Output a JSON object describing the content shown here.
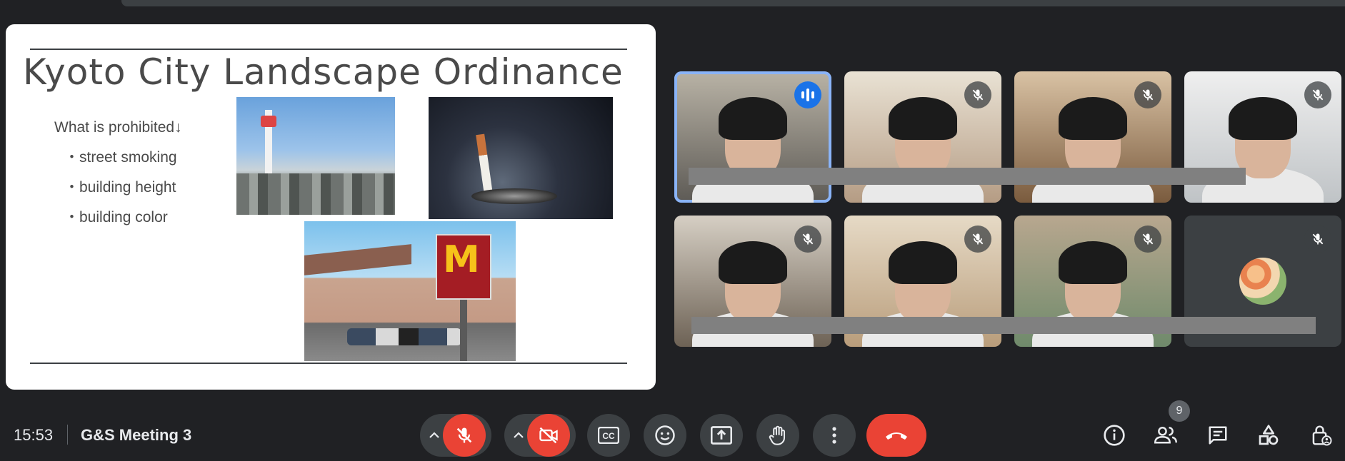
{
  "slide": {
    "title": "Kyoto City Landscape Ordinance",
    "heading": "What is prohibited↓",
    "bullets": [
      "・street smoking",
      "・building height",
      "・building color"
    ],
    "images": [
      "kyoto-tower-photo",
      "cigarette-photo",
      "mcdonalds-sign-photo"
    ],
    "mcd_sign_glyph": "M"
  },
  "participants": [
    {
      "id": "p1",
      "state": "speaking",
      "active": true,
      "colors": [
        "#b9b3a6",
        "#5d5a55"
      ]
    },
    {
      "id": "p2",
      "state": "muted",
      "colors": [
        "#e9e2d4",
        "#b59c84"
      ]
    },
    {
      "id": "p3",
      "state": "muted",
      "colors": [
        "#d9c2a4",
        "#7a5b3e"
      ]
    },
    {
      "id": "p4",
      "state": "muted",
      "colors": [
        "#efefef",
        "#bfc3c6"
      ]
    },
    {
      "id": "p5",
      "state": "muted",
      "colors": [
        "#d6cfc4",
        "#6d6255"
      ]
    },
    {
      "id": "p6",
      "state": "muted",
      "colors": [
        "#e6dac6",
        "#b99d7b"
      ]
    },
    {
      "id": "p7",
      "state": "muted",
      "colors": [
        "#b8a78f",
        "#6f8a6b"
      ]
    },
    {
      "id": "p8",
      "state": "muted",
      "avatar": "flower-avatar",
      "colors": [
        "#3c4043",
        "#3c4043"
      ]
    }
  ],
  "meeting": {
    "time": "15:53",
    "name": "G&S Meeting 3",
    "participant_count": "9"
  },
  "controls": {
    "mic": "mic-off",
    "camera": "camera-off",
    "captions": "CC",
    "accent_red": "#ea4335",
    "accent_blue": "#1a73e8"
  }
}
